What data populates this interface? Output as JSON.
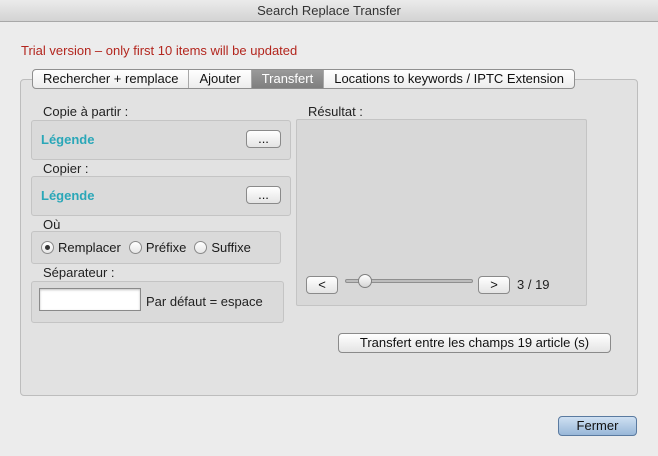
{
  "window": {
    "title": "Search Replace Transfer"
  },
  "trial_notice": "Trial version – only first 10 items will be updated",
  "tabs": [
    {
      "label": "Rechercher + remplace",
      "selected": false
    },
    {
      "label": "Ajouter",
      "selected": false
    },
    {
      "label": "Transfert",
      "selected": true
    },
    {
      "label": "Locations to keywords / IPTC Extension",
      "selected": false
    }
  ],
  "copy_from": {
    "label": "Copie à partir :",
    "value": "Légende",
    "browse_label": "..."
  },
  "copy_to": {
    "label": "Copier :",
    "value": "Légende",
    "browse_label": "..."
  },
  "where": {
    "label": "Où",
    "options": [
      {
        "label": "Remplacer",
        "checked": true
      },
      {
        "label": "Préfixe",
        "checked": false
      },
      {
        "label": "Suffixe",
        "checked": false
      }
    ]
  },
  "separator": {
    "label": "Séparateur :",
    "value": "",
    "hint": "Par défaut = espace"
  },
  "result": {
    "label": "Résultat :",
    "prev_label": "<",
    "next_label": ">",
    "page_current": 3,
    "page_total": 19,
    "page_text": "3 / 19",
    "slider_fraction": 0.11
  },
  "transfer_button": "Transfert entre les champs 19 article (s)",
  "close_button": "Fermer",
  "colors": {
    "trial": "#b3261e",
    "field_value": "#2aa7b8",
    "selected_tab": "#8a8a8a"
  }
}
